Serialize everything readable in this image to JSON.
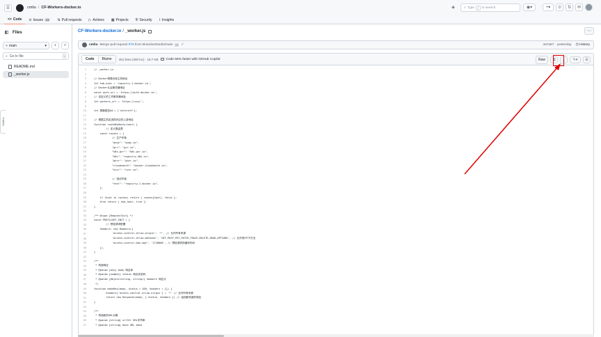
{
  "repo": {
    "owner": "cmliu",
    "name": "CF-Workers-docker.io"
  },
  "search": {
    "placeholder_prefix": "Type",
    "kbd": "/",
    "placeholder_suffix": "to search"
  },
  "tabs": [
    {
      "label": "Code",
      "count": ""
    },
    {
      "label": "Issues",
      "count": "24"
    },
    {
      "label": "Pull requests",
      "count": ""
    },
    {
      "label": "Actions",
      "count": ""
    },
    {
      "label": "Projects",
      "count": ""
    },
    {
      "label": "Security",
      "count": ""
    },
    {
      "label": "Insights",
      "count": ""
    }
  ],
  "sidebar": {
    "title": "Files",
    "branch": "main",
    "goto_placeholder": "Go to file",
    "goto_kbd": "t",
    "files": [
      {
        "name": "README.md"
      },
      {
        "name": "_worker.js"
      }
    ],
    "panel_tab": "Outline"
  },
  "path": {
    "repo": "CF-Workers-docker.io",
    "sep": "/",
    "file": "_worker.js"
  },
  "commit": {
    "author": "cmliu",
    "message_prefix": "Merge pull request",
    "pr": "#74",
    "message_suffix": "from BrandonStudio/main",
    "hash_time": "4a7a57 · yesterday",
    "history": "History"
  },
  "file_header": {
    "code_tab": "Code",
    "blame_tab": "Blame",
    "info": "461 lines (400 loc) · 19.7 KB",
    "copilot": "Code 55% faster with GitHub Copilot",
    "raw": "Raw"
  },
  "code_lines": [
    {
      "n": "1",
      "t": "// _worker.js"
    },
    {
      "n": "2",
      "t": ""
    },
    {
      "n": "3",
      "t": "// Docker镜像仓库主机地址"
    },
    {
      "n": "4",
      "t": "let hub_host = 'registry-1.docker.io';"
    },
    {
      "n": "5",
      "t": "// Docker认证服务器地址"
    },
    {
      "n": "6",
      "t": "const auth_url = 'https://auth.docker.io';"
    },
    {
      "n": "7",
      "t": "// 自定义的工作服务器地址"
    },
    {
      "n": "8",
      "t": "let workers_url = 'https://xxx/';"
    },
    {
      "n": "9",
      "t": ""
    },
    {
      "n": "10",
      "t": "let 屏蔽爬虫UA = ['netcraft'];"
    },
    {
      "n": "11",
      "t": ""
    },
    {
      "n": "12",
      "t": "// 根据主机名选择对应的上游地址"
    },
    {
      "n": "13",
      "t": "function routeByHosts(host) {"
    },
    {
      "n": "14",
      "t": "        // 定义路由表"
    },
    {
      "n": "15",
      "t": "    const routes = {"
    },
    {
      "n": "16",
      "t": "            // 生产环境"
    },
    {
      "n": "17",
      "t": "            \"quay\": \"quay.io\","
    },
    {
      "n": "18",
      "t": "            \"gcr\": \"gcr.io\","
    },
    {
      "n": "19",
      "t": "            \"k8s-gcr\": \"k8s.gcr.io\","
    },
    {
      "n": "20",
      "t": "            \"k8s\": \"registry.k8s.io\","
    },
    {
      "n": "21",
      "t": "            \"ghcr\": \"ghcr.io\","
    },
    {
      "n": "22",
      "t": "            \"cloudsmith\": \"docker.cloudsmith.io\","
    },
    {
      "n": "23",
      "t": "            \"nvcr\": \"nvcr.io\","
    },
    {
      "n": "24",
      "t": ""
    },
    {
      "n": "25",
      "t": "            // 测试环境"
    },
    {
      "n": "26",
      "t": "            \"test\": \"registry-1.docker.io\","
    },
    {
      "n": "27",
      "t": "    };"
    },
    {
      "n": "28",
      "t": ""
    },
    {
      "n": "29",
      "t": "    if (host in routes) return [ routes[host], false ];"
    },
    {
      "n": "30",
      "t": "    else return [ hub_host, true ];"
    },
    {
      "n": "31",
      "t": "}"
    },
    {
      "n": "32",
      "t": ""
    },
    {
      "n": "33",
      "t": "/** @type {RequestInit} */"
    },
    {
      "n": "34",
      "t": "const PREFLIGHT_INIT = {"
    },
    {
      "n": "35",
      "t": "        // 预检请求配置"
    },
    {
      "n": "36",
      "t": "    headers: new Headers({"
    },
    {
      "n": "37",
      "t": "            'access-control-allow-origin': '*', // 允许所有来源"
    },
    {
      "n": "38",
      "t": "            'access-control-allow-methods': 'GET,POST,PUT,PATCH,TRACE,DELETE,HEAD,OPTIONS', // 允许的HTTP方法"
    },
    {
      "n": "39",
      "t": "            'access-control-max-age': '1728000', // 预检请求的缓存时间"
    },
    {
      "n": "40",
      "t": "    }),"
    },
    {
      "n": "41",
      "t": "}"
    },
    {
      "n": "42",
      "t": ""
    },
    {
      "n": "43",
      "t": "/**"
    },
    {
      "n": "44",
      "t": " * 构造响应"
    },
    {
      "n": "45",
      "t": " * @param {any} body 响应体"
    },
    {
      "n": "46",
      "t": " * @param {number} status 响应状态码"
    },
    {
      "n": "47",
      "t": " * @param {Object<string, string>} headers 响应头"
    },
    {
      "n": "48",
      "t": " */"
    },
    {
      "n": "49",
      "t": "function makeRes(body, status = 200, headers = {}) {"
    },
    {
      "n": "50",
      "t": "        headers['access-control-allow-origin'] = '*' // 允许所有来源"
    },
    {
      "n": "51",
      "t": "        return new Response(body, { status, headers }) // 返回新构造的响应"
    },
    {
      "n": "52",
      "t": "}"
    },
    {
      "n": "53",
      "t": ""
    },
    {
      "n": "54",
      "t": "/**"
    },
    {
      "n": "55",
      "t": " * 构造新的URL对象"
    },
    {
      "n": "56",
      "t": " * @param {string} urlStr URL字符串"
    },
    {
      "n": "57",
      "t": " * @param {string} base URL base"
    }
  ],
  "colors": {
    "accent": "#0969da",
    "annotation": "#e00000",
    "tab_underline": "#fd8c73"
  }
}
